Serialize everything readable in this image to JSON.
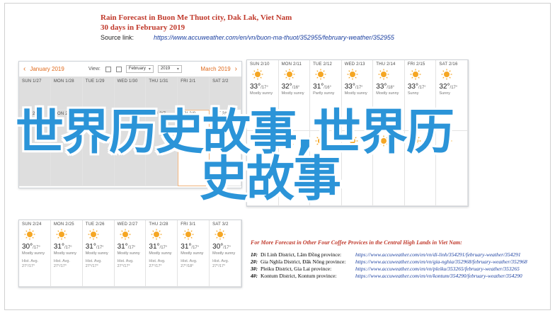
{
  "header": {
    "title": "Rain Forecast in Buon Me Thuot city, Dak Lak, Viet Nam",
    "subtitle": "30 days in February 2019",
    "source_label": "Source link:",
    "source_url": "https://www.accuweather.com/en/vn/buon-ma-thuot/352955/february-weather/352955"
  },
  "calendar_left": {
    "prev_month": "January 2019",
    "view_label": "View:",
    "month_select": "February",
    "year_select": "2019",
    "next_month": "March 2019",
    "days": [
      "SUN 1/27",
      "MON 1/28",
      "TUE 1/29",
      "WED 1/30",
      "THU 1/31",
      "FRI 2/1",
      "SAT 2/2"
    ],
    "row1_temps": [
      "",
      "",
      "",
      "",
      "",
      "",
      ""
    ],
    "row2": [
      {
        "day": "SUN 2/3",
        "temp": "",
        "lo": "",
        "desc": "",
        "hist": ""
      },
      {
        "day": "MON 2/4",
        "temp": "",
        "lo": "",
        "desc": "",
        "hist": ""
      },
      {
        "day": "TUE 2/5",
        "temp": "",
        "lo": "",
        "desc": "",
        "hist": ""
      },
      {
        "day": "WED 2/6",
        "temp": "",
        "lo": "",
        "desc": "",
        "hist": ""
      },
      {
        "day": "THU 2/7",
        "temp": "",
        "lo": "",
        "desc": "",
        "hist": ""
      },
      {
        "day": "FRI 2/8",
        "temp": "",
        "lo": "",
        "desc": "",
        "hist": ""
      },
      {
        "day": "SAT 2/9",
        "temp": "",
        "lo": "",
        "desc": "",
        "hist": ""
      }
    ]
  },
  "calendar_right": {
    "cells": [
      {
        "day": "SUN 2/10",
        "temp": "33°",
        "lo": "/17°",
        "desc": "Mostly sunny",
        "hist": ""
      },
      {
        "day": "MON 2/11",
        "temp": "32°",
        "lo": "/16°",
        "desc": "Mostly sunny",
        "hist": ""
      },
      {
        "day": "TUE 2/12",
        "temp": "31°",
        "lo": "/16°",
        "desc": "Partly sunny",
        "hist": ""
      },
      {
        "day": "WED 2/13",
        "temp": "33°",
        "lo": "/17°",
        "desc": "Mostly sunny",
        "hist": ""
      },
      {
        "day": "THU 2/14",
        "temp": "33°",
        "lo": "/18°",
        "desc": "Mostly sunny",
        "hist": ""
      },
      {
        "day": "FRI 2/15",
        "temp": "33°",
        "lo": "/17°",
        "desc": "Sunny",
        "hist": ""
      },
      {
        "day": "SAT 2/16",
        "temp": "32°",
        "lo": "/17°",
        "desc": "Sunny",
        "hist": ""
      }
    ]
  },
  "calendar_bottom": {
    "cells": [
      {
        "day": "SUN 2/24",
        "temp": "30°",
        "lo": "/17°",
        "desc": "Mostly sunny",
        "hist": "Hist. Avg.\n27°/17°"
      },
      {
        "day": "MON 2/25",
        "temp": "31°",
        "lo": "/17°",
        "desc": "Mostly sunny",
        "hist": "Hist. Avg.\n27°/17°"
      },
      {
        "day": "TUE 2/26",
        "temp": "31°",
        "lo": "/17°",
        "desc": "Mostly sunny",
        "hist": "Hist. Avg.\n27°/17°"
      },
      {
        "day": "WED 2/27",
        "temp": "31°",
        "lo": "/17°",
        "desc": "Mostly sunny",
        "hist": "Hist. Avg.\n27°/17°"
      },
      {
        "day": "THU 2/28",
        "temp": "31°",
        "lo": "/17°",
        "desc": "Mostly sunny",
        "hist": "Hist. Avg.\n27°/17°"
      },
      {
        "day": "FRI 3/1",
        "temp": "31°",
        "lo": "/17°",
        "desc": "Mostly sunny",
        "hist": "Hist. Avg.\n27°/18°"
      },
      {
        "day": "SAT 3/2",
        "temp": "30°",
        "lo": "/17°",
        "desc": "Mostly sunny",
        "hist": "Hist. Avg.\n27°/17°"
      }
    ]
  },
  "more_forecast": {
    "title": "For More Forecast in Other Four Coffee Provices in the Central High Lands in Viet Nam:",
    "rows": [
      {
        "n": "1#:",
        "name": "Di Linh District, Lâm Đồng province:",
        "url": "https://www.accuweather.com/en/vn/di-linh/354291/february-weather/354291"
      },
      {
        "n": "2#:",
        "name": "Gia Nghĩa District, Đăk Nông province:",
        "url": "https://www.accuweather.com/en/vn/gia-nghia/352968/february-weather/352968"
      },
      {
        "n": "3#:",
        "name": "Pleiku District, Gia Lai province:",
        "url": "https://www.accuweather.com/en/vn/pleiku/353265/february-weather/353265"
      },
      {
        "n": "4#:",
        "name": "Kontum District, Kontum province:",
        "url": "https://www.accuweather.com/en/vn/kontum/354290/february-weather/354290"
      }
    ]
  },
  "watermark": {
    "line1": "世界历史故事,世界历",
    "line2": "史故事"
  },
  "colors": {
    "accent": "#c0392b",
    "link": "#1a3fa0",
    "sun": "#f5a623",
    "watermark": "#2b94d8"
  }
}
